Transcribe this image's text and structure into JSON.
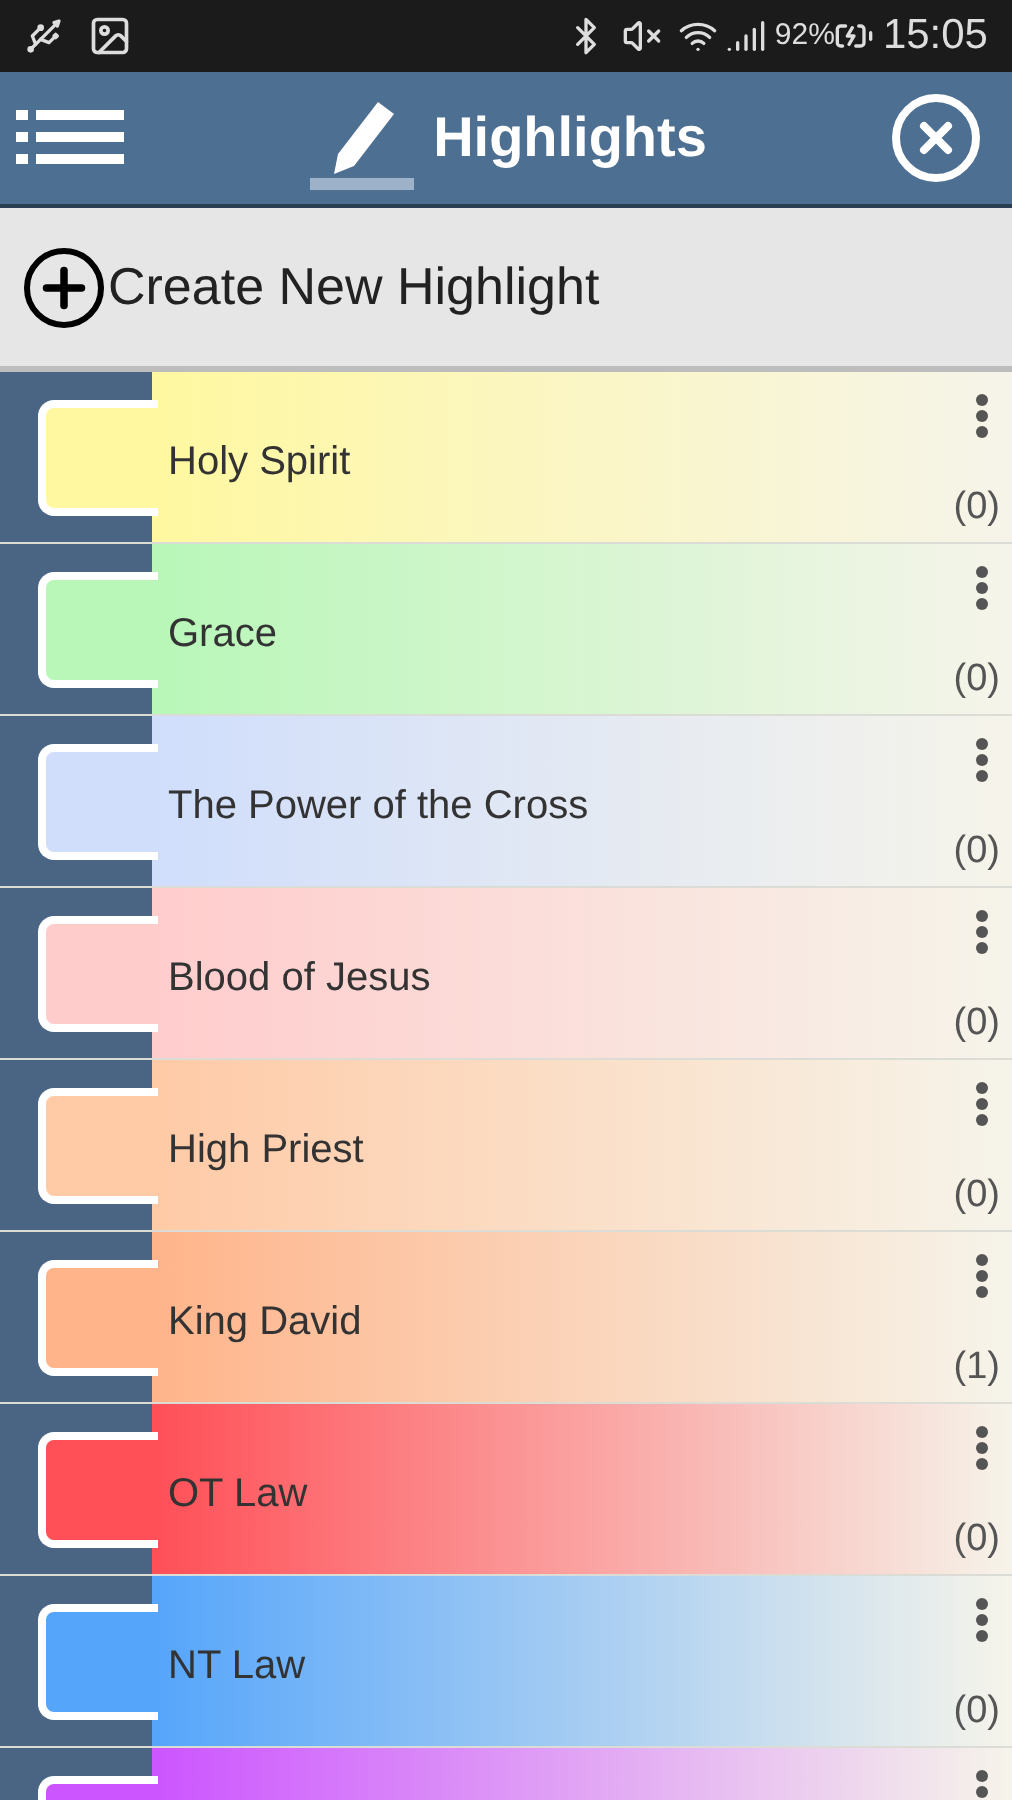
{
  "status_bar": {
    "battery": "92%",
    "time": "15:05"
  },
  "toolbar": {
    "title": "Highlights"
  },
  "create_button": {
    "label": "Create New Highlight"
  },
  "highlights": [
    {
      "name": "Holy Spirit",
      "count": "(0)",
      "color": "#fff8a0"
    },
    {
      "name": "Grace",
      "count": "(0)",
      "color": "#b8f7b8"
    },
    {
      "name": "The Power of the Cross",
      "count": "(0)",
      "color": "#d0defc"
    },
    {
      "name": "Blood of Jesus",
      "count": "(0)",
      "color": "#ffcccc"
    },
    {
      "name": "High Priest",
      "count": "(0)",
      "color": "#ffcaa6"
    },
    {
      "name": "King David",
      "count": "(1)",
      "color": "#ffb48a"
    },
    {
      "name": "OT Law",
      "count": "(0)",
      "color": "#ff4f57"
    },
    {
      "name": "NT Law",
      "count": "(0)",
      "color": "#55a5fb"
    },
    {
      "color": "#cc55ff"
    }
  ]
}
